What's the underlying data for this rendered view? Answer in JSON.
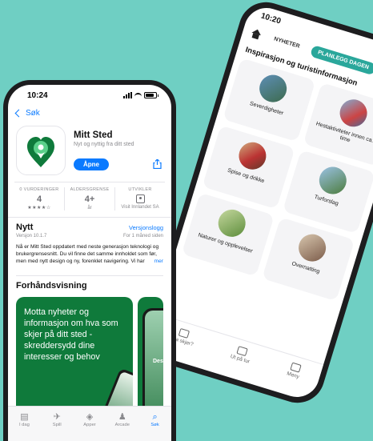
{
  "front": {
    "status_time": "10:24",
    "back_label": "Søk",
    "app": {
      "name": "Mitt Sted",
      "subtitle": "Nyt og nyttig fra ditt sted",
      "get_label": "Åpne"
    },
    "ratings": [
      {
        "header": "0 VURDERINGER",
        "value": "4",
        "sub": "★★★★☆"
      },
      {
        "header": "ALDERSGRENSE",
        "value": "4+",
        "sub": "år"
      },
      {
        "header": "UTVIKLER",
        "value": "",
        "sub": "Visit Innlandet SA"
      }
    ],
    "nytt": {
      "title": "Nytt",
      "history_link": "Versjonslogg",
      "version": "Versjon 10.1.7",
      "age": "For 1 måned siden",
      "text": "Nå er Mitt Sted oppdatert med neste generasjon teknologi og brukergrensesnitt. Du vil finne det samme innholdet som før, men med nytt design og ny, forenklet navigering. Vi har",
      "more": "mer"
    },
    "preview": {
      "title": "Forhåndsvisning",
      "shot_text": "Motta nyheter og informasjon om hva som skjer på ditt sted - skreddersydd dine interesser og behov",
      "second_label": "Destinasjoner"
    },
    "tabbar": [
      {
        "label": "I dag",
        "glyph": "▤"
      },
      {
        "label": "Spill",
        "glyph": "✈"
      },
      {
        "label": "Apper",
        "glyph": "◈"
      },
      {
        "label": "Arcade",
        "glyph": "♟"
      },
      {
        "label": "Søk",
        "glyph": "⌕",
        "active": true
      }
    ]
  },
  "back": {
    "status_time": "10:20",
    "tabs": [
      "NYHETER",
      "PLANLEGG DAGEN"
    ],
    "active_tab": "PLANLEGG DAGEN",
    "heading": "Inspirasjon og turistinformasjon",
    "cards": [
      "Severdigheter",
      "Hestaktiviteter innen ca. 1 time",
      "Spise og drikke",
      "Turforslag",
      "Naturer og opplevelser",
      "Overnatting"
    ],
    "nav": [
      "Hva skjer?",
      "Ut på tur",
      "Meny"
    ]
  },
  "colors": {
    "background": "#6fcfc3",
    "accent": "#0a7aff",
    "brand_green": "#0f7a3b",
    "teal_tab": "#2aa79b"
  }
}
